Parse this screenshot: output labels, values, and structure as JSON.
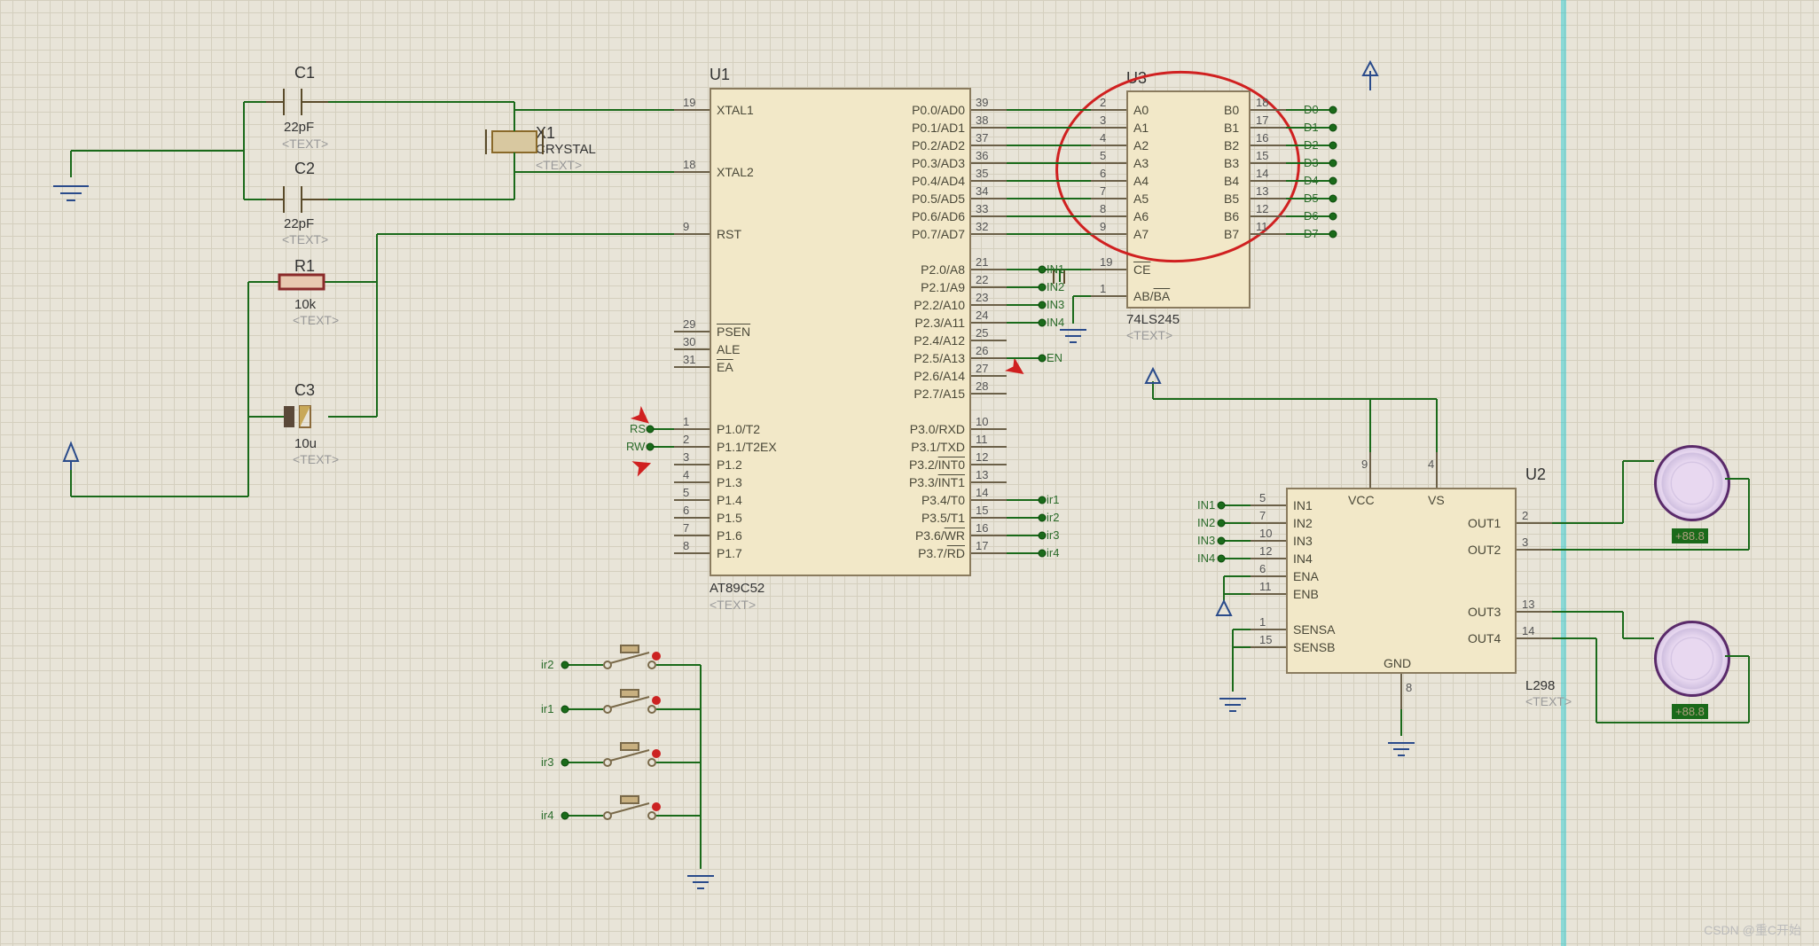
{
  "watermark": "CSDN @重C开始",
  "components": {
    "C1": {
      "ref": "C1",
      "value": "22pF",
      "placeholder": "<TEXT>"
    },
    "C2": {
      "ref": "C2",
      "value": "22pF",
      "placeholder": "<TEXT>"
    },
    "C3": {
      "ref": "C3",
      "value": "10u",
      "placeholder": "<TEXT>"
    },
    "R1": {
      "ref": "R1",
      "value": "10k",
      "placeholder": "<TEXT>"
    },
    "X1": {
      "ref": "X1",
      "value": "CRYSTAL",
      "placeholder": "<TEXT>"
    },
    "U1": {
      "ref": "U1",
      "value": "AT89C52",
      "placeholder": "<TEXT>"
    },
    "U2": {
      "ref": "U2",
      "value": "L298",
      "placeholder": "<TEXT>"
    },
    "U3": {
      "ref": "U3",
      "value": "74LS245",
      "placeholder": "<TEXT>"
    }
  },
  "U1_left": [
    {
      "num": "19",
      "name": "XTAL1"
    },
    {
      "num": "18",
      "name": "XTAL2"
    },
    {
      "num": "9",
      "name": "RST"
    },
    {
      "num": "29",
      "name": "PSEN",
      "bar": true
    },
    {
      "num": "30",
      "name": "ALE"
    },
    {
      "num": "31",
      "name": "EA",
      "bar": true
    },
    {
      "num": "1",
      "name": "P1.0/T2"
    },
    {
      "num": "2",
      "name": "P1.1/T2EX"
    },
    {
      "num": "3",
      "name": "P1.2"
    },
    {
      "num": "4",
      "name": "P1.3"
    },
    {
      "num": "5",
      "name": "P1.4"
    },
    {
      "num": "6",
      "name": "P1.5"
    },
    {
      "num": "7",
      "name": "P1.6"
    },
    {
      "num": "8",
      "name": "P1.7"
    }
  ],
  "U1_right": [
    {
      "num": "39",
      "name": "P0.0/AD0"
    },
    {
      "num": "38",
      "name": "P0.1/AD1"
    },
    {
      "num": "37",
      "name": "P0.2/AD2"
    },
    {
      "num": "36",
      "name": "P0.3/AD3"
    },
    {
      "num": "35",
      "name": "P0.4/AD4"
    },
    {
      "num": "34",
      "name": "P0.5/AD5"
    },
    {
      "num": "33",
      "name": "P0.6/AD6"
    },
    {
      "num": "32",
      "name": "P0.7/AD7"
    },
    {
      "num": "21",
      "name": "P2.0/A8"
    },
    {
      "num": "22",
      "name": "P2.1/A9"
    },
    {
      "num": "23",
      "name": "P2.2/A10"
    },
    {
      "num": "24",
      "name": "P2.3/A11"
    },
    {
      "num": "25",
      "name": "P2.4/A12"
    },
    {
      "num": "26",
      "name": "P2.5/A13"
    },
    {
      "num": "27",
      "name": "P2.6/A14"
    },
    {
      "num": "28",
      "name": "P2.7/A15"
    },
    {
      "num": "10",
      "name": "P3.0/RXD"
    },
    {
      "num": "11",
      "name": "P3.1/TXD"
    },
    {
      "num": "12",
      "name": "P3.2/INT0",
      "bar": "INT0"
    },
    {
      "num": "13",
      "name": "P3.3/INT1",
      "bar": "INT1"
    },
    {
      "num": "14",
      "name": "P3.4/T0"
    },
    {
      "num": "15",
      "name": "P3.5/T1"
    },
    {
      "num": "16",
      "name": "P3.6/WR",
      "bar": "WR"
    },
    {
      "num": "17",
      "name": "P3.7/RD",
      "bar": "RD"
    }
  ],
  "U3_left": [
    {
      "num": "2",
      "name": "A0"
    },
    {
      "num": "3",
      "name": "A1"
    },
    {
      "num": "4",
      "name": "A2"
    },
    {
      "num": "5",
      "name": "A3"
    },
    {
      "num": "6",
      "name": "A4"
    },
    {
      "num": "7",
      "name": "A5"
    },
    {
      "num": "8",
      "name": "A6"
    },
    {
      "num": "9",
      "name": "A7"
    },
    {
      "num": "19",
      "name": "CE",
      "bar": true
    },
    {
      "num": "1",
      "name": "AB/BA",
      "bar": "BA"
    }
  ],
  "U3_right": [
    {
      "num": "18",
      "name": "B0"
    },
    {
      "num": "17",
      "name": "B1"
    },
    {
      "num": "16",
      "name": "B2"
    },
    {
      "num": "15",
      "name": "B3"
    },
    {
      "num": "14",
      "name": "B4"
    },
    {
      "num": "13",
      "name": "B5"
    },
    {
      "num": "12",
      "name": "B6"
    },
    {
      "num": "11",
      "name": "B7"
    }
  ],
  "U2_left": [
    {
      "num": "5",
      "name": "IN1"
    },
    {
      "num": "7",
      "name": "IN2"
    },
    {
      "num": "10",
      "name": "IN3"
    },
    {
      "num": "12",
      "name": "IN4"
    },
    {
      "num": "6",
      "name": "ENA"
    },
    {
      "num": "11",
      "name": "ENB"
    },
    {
      "num": "1",
      "name": "SENSA"
    },
    {
      "num": "15",
      "name": "SENSB"
    }
  ],
  "U2_right": [
    {
      "num": "2",
      "name": "OUT1"
    },
    {
      "num": "3",
      "name": "OUT2"
    },
    {
      "num": "13",
      "name": "OUT3"
    },
    {
      "num": "14",
      "name": "OUT4"
    }
  ],
  "U2_top": [
    {
      "num": "9",
      "name": "VCC"
    },
    {
      "num": "4",
      "name": "VS"
    }
  ],
  "U2_bot": {
    "num": "8",
    "name": "GND"
  },
  "netlabels": {
    "IN1": "IN1",
    "IN2": "IN2",
    "IN3": "IN3",
    "IN4": "IN4",
    "EN": "EN",
    "ir1": "ir1",
    "ir2": "ir2",
    "ir3": "ir3",
    "ir4": "ir4",
    "RS": "RS",
    "RW": "RW",
    "D0": "D0",
    "D1": "D1",
    "D2": "D2",
    "D3": "D3",
    "D4": "D4",
    "D5": "D5",
    "D6": "D6",
    "D7": "D7",
    "sw_ir1": "ir1",
    "sw_ir2": "ir2",
    "sw_ir3": "ir3",
    "sw_ir4": "ir4",
    "u2_IN1": "IN1",
    "u2_IN2": "IN2",
    "u2_IN3": "IN3",
    "u2_IN4": "IN4"
  }
}
